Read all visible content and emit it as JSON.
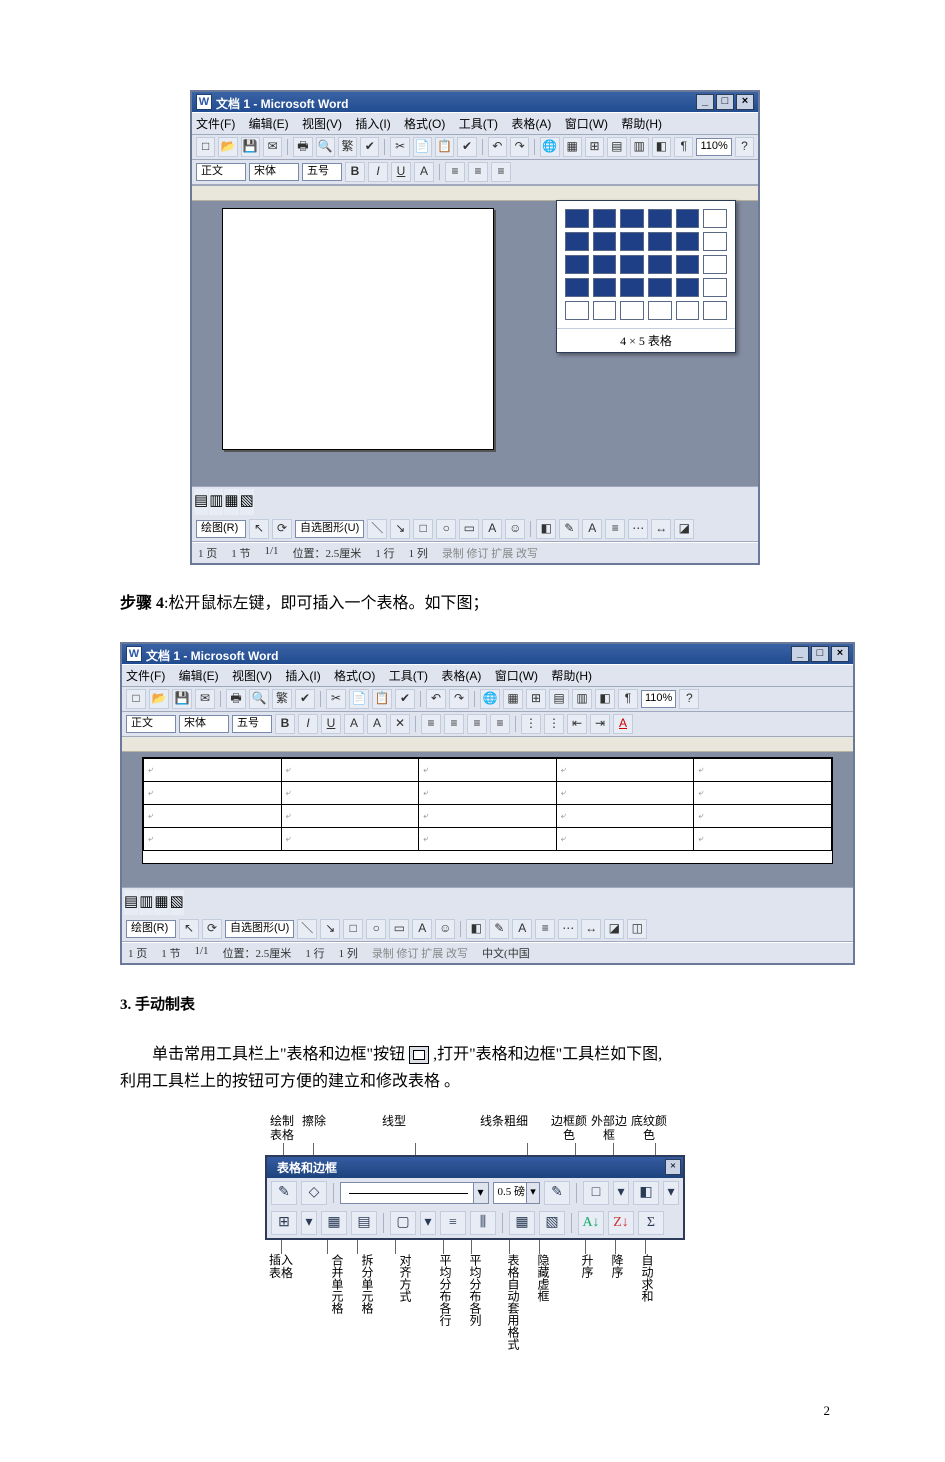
{
  "pageNumber": "2",
  "step4": {
    "label": "步骤 4",
    "text": ":松开鼠标左键，即可插入一个表格。如下图；"
  },
  "section3": {
    "num": "3.",
    "title": "手动制表"
  },
  "para3": {
    "t1": "单击常用工具栏上\"表格和边框\"按钮",
    "t2": ",打开\"表格和边框\"工具栏如下图,",
    "t3": "利用工具栏上的按钮可方便的建立和修改表格 。"
  },
  "wordWin": {
    "title": "文档 1 - Microsoft Word",
    "menus": [
      "文件(F)",
      "编辑(E)",
      "视图(V)",
      "插入(I)",
      "格式(O)",
      "工具(T)",
      "表格(A)",
      "窗口(W)",
      "帮助(H)"
    ],
    "zoom": "110%",
    "styleBox": "正文",
    "fontBox": "宋体",
    "sizeBox": "五号",
    "picker": "4 × 5 表格",
    "draw": "绘图(R)",
    "shapes": "自选图形(U)",
    "status": {
      "page": "1 页",
      "section": "1 节",
      "pos": "1/1",
      "loc": "位置：2.5厘米",
      "row": "1 行",
      "col": "1 列",
      "modes": "录制 修订 扩展 改写"
    }
  },
  "wordWin2": {
    "status_lang": "中文(中国"
  },
  "tlb": {
    "title": "表格和边框",
    "lineWeight": "0.5 磅",
    "topLabels": {
      "draw": "绘制表格",
      "erase": "擦除",
      "lineStyle": "线型",
      "lineWeight": "线条粗细",
      "borderColor": "边框颜色",
      "outsideBorder": "外部边框",
      "shading": "底纹颜色"
    },
    "botLabels": {
      "insert": "插入表格",
      "merge": "合并单元格",
      "split": "拆分单元格",
      "align": "对齐方式",
      "rows": "平均分布各行",
      "cols": "平均分布各列",
      "autofmt": "表格自动套用格式",
      "hide": "隐藏虚框",
      "asc": "升序",
      "desc": "降序",
      "sum": "自动求和"
    }
  }
}
